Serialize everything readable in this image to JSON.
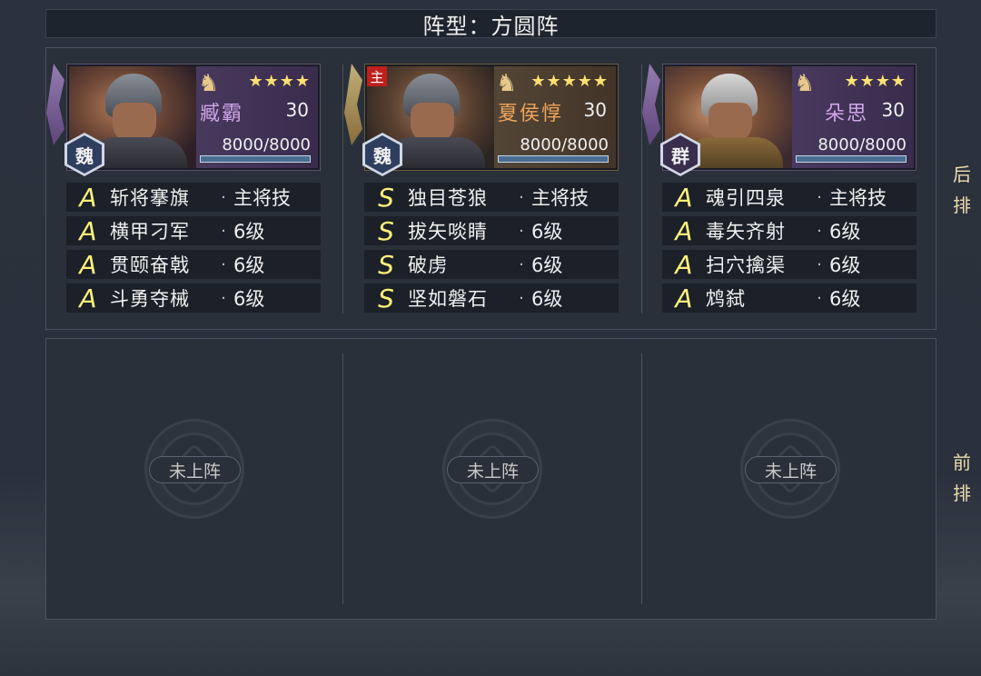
{
  "formation": {
    "title": "阵型：方圆阵"
  },
  "rows": {
    "back_label": "后\n排",
    "back_chars": [
      "后",
      "排"
    ],
    "front_chars": [
      "前",
      "排"
    ]
  },
  "back_row": [
    {
      "name": "臧霸",
      "stars": "★★★★",
      "level": "30",
      "hp": "8000/8000",
      "faction": "魏",
      "is_lord": false,
      "rarity": "purple",
      "skills": [
        {
          "grade": "A",
          "name": "斩将搴旗",
          "tag": "主将技"
        },
        {
          "grade": "A",
          "name": "横甲刁军",
          "tag": "6级"
        },
        {
          "grade": "A",
          "name": "贯颐奋戟",
          "tag": "6级"
        },
        {
          "grade": "A",
          "name": "斗勇夺械",
          "tag": "6级"
        }
      ]
    },
    {
      "name": "夏侯惇",
      "stars": "★★★★★",
      "level": "30",
      "hp": "8000/8000",
      "faction": "魏",
      "is_lord": true,
      "lord_badge": "主",
      "rarity": "gold",
      "skills": [
        {
          "grade": "S",
          "name": "独目苍狼",
          "tag": "主将技"
        },
        {
          "grade": "S",
          "name": "拔矢啖睛",
          "tag": "6级"
        },
        {
          "grade": "S",
          "name": "破虏",
          "tag": "6级"
        },
        {
          "grade": "S",
          "name": "坚如磐石",
          "tag": "6级"
        }
      ]
    },
    {
      "name": "朵思",
      "stars": "★★★★",
      "level": "30",
      "hp": "8000/8000",
      "faction": "群",
      "is_lord": false,
      "rarity": "purple",
      "skills": [
        {
          "grade": "A",
          "name": "魂引四泉",
          "tag": "主将技"
        },
        {
          "grade": "A",
          "name": "毒矢齐射",
          "tag": "6级"
        },
        {
          "grade": "A",
          "name": "扫穴擒渠",
          "tag": "6级"
        },
        {
          "grade": "A",
          "name": "鸩弑",
          "tag": "6级"
        }
      ]
    }
  ],
  "front_row": [
    {
      "label": "未上阵"
    },
    {
      "label": "未上阵"
    },
    {
      "label": "未上阵"
    }
  ],
  "separator": "·"
}
